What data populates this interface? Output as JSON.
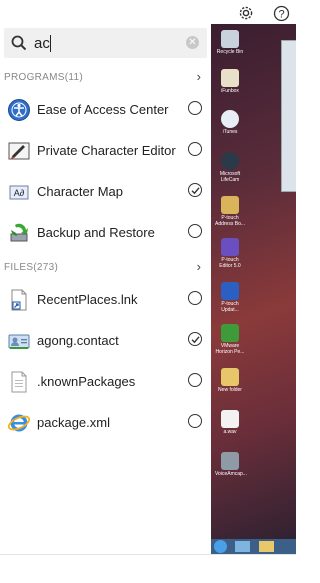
{
  "search": {
    "value": "ac"
  },
  "sections": {
    "programs": {
      "label": "PROGRAMS(11)"
    },
    "files": {
      "label": "FILES(273)"
    }
  },
  "programs": [
    {
      "label": "Ease of Access Center",
      "checked": false
    },
    {
      "label": "Private Character Editor",
      "checked": false
    },
    {
      "label": "Character Map",
      "checked": true
    },
    {
      "label": "Backup and Restore",
      "checked": false
    }
  ],
  "files": [
    {
      "label": "RecentPlaces.lnk",
      "checked": false
    },
    {
      "label": "agong.contact",
      "checked": true
    },
    {
      "label": ".knownPackages",
      "checked": false
    },
    {
      "label": "package.xml",
      "checked": false
    }
  ],
  "desktop_icons": [
    {
      "label": "Recycle Bin"
    },
    {
      "label": "iFunbox"
    },
    {
      "label": "iTunes"
    },
    {
      "label": "Microsoft LifeCam"
    },
    {
      "label": "P-touch Address Bo..."
    },
    {
      "label": "P-touch Editor 5.0"
    },
    {
      "label": "P-touch Updat..."
    },
    {
      "label": "VMware Horizon Pe..."
    },
    {
      "label": "New folder"
    },
    {
      "label": "a.wav"
    },
    {
      "label": "VoiceAmcap..."
    }
  ]
}
